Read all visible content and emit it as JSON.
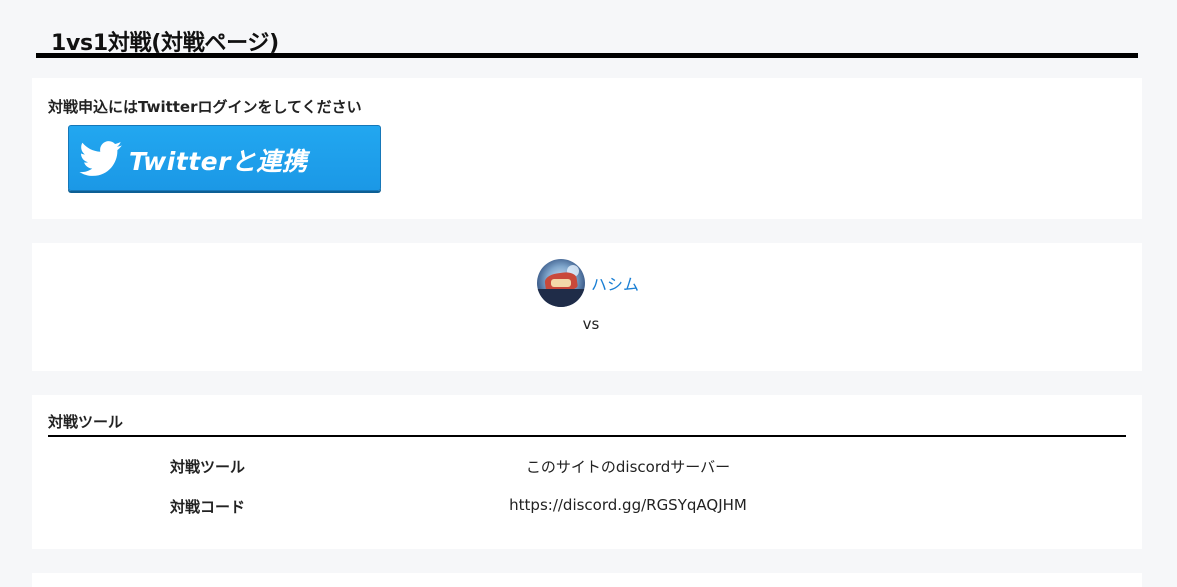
{
  "page": {
    "title": "1vs1対戦(対戦ページ)"
  },
  "login": {
    "message": "対戦申込にはTwitterログインをしてください",
    "button_label": "Twitterと連携",
    "button_icon": "twitter-bird-icon",
    "button_color": "#1DA1F2"
  },
  "match": {
    "player1": {
      "name": "ハシム",
      "avatar": "player-avatar"
    },
    "vs_label": "vs"
  },
  "tools": {
    "heading": "対戦ツール",
    "rows": [
      {
        "label": "対戦ツール",
        "value": "このサイトのdiscordサーバー"
      },
      {
        "label": "対戦コード",
        "value": "https://discord.gg/RGSYqAQJHM"
      }
    ]
  },
  "colors": {
    "background": "#f6f7f9",
    "card": "#ffffff",
    "link": "#1a7fd4",
    "rule": "#000000"
  }
}
